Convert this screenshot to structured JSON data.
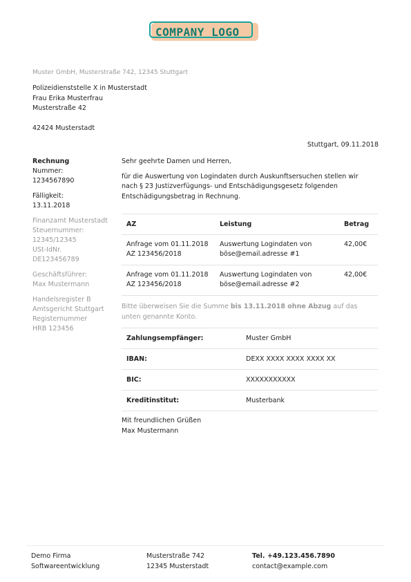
{
  "logo": {
    "text": "COMPANY LOGO"
  },
  "sender_line": "Muster GmbH, Musterstraße 742, 12345 Stuttgart",
  "recipient": {
    "lines": [
      "Polizeidienststelle X in Musterstadt",
      "Frau Erika Musterfrau",
      "Musterstraße 42"
    ],
    "city": "42424 Musterstadt"
  },
  "date": "Stuttgart, 09.11.2018",
  "sidebar": {
    "title": "Rechnung",
    "number_label": "Nummer:",
    "number": "1234567890",
    "due_label": "Fälligkeit:",
    "due": "13.11.2018",
    "tax": [
      "Finanzamt Musterstadt",
      "Steuernummer:",
      "12345/12345",
      "USt-IdNr.",
      "DE123456789"
    ],
    "ceo": [
      "Geschäftsführer:",
      "Max Mustermann"
    ],
    "register": [
      "Handelsregister B",
      "Amtsgericht Stuttgart",
      "Registernummer",
      "HRB 123456"
    ]
  },
  "body": {
    "salutation": "Sehr geehrte Damen und Herren,",
    "intro_lines": [
      "für die Auswertung von Logindaten durch Auskunftsersuchen stellen wir",
      "nach § 23 Justizverfügungs- und Entschädigungsgesetz folgenden",
      "Entschädigungsbetrag in Rechnung."
    ]
  },
  "table": {
    "headers": [
      "AZ",
      "Leistung",
      "Betrag"
    ],
    "rows": [
      {
        "az": [
          "Anfrage vom 01.11.2018",
          "AZ 123456/2018"
        ],
        "leistung": [
          "Auswertung Logindaten von",
          "böse@email.adresse #1"
        ],
        "betrag": "42,00€"
      },
      {
        "az": [
          "Anfrage vom 01.11.2018",
          "AZ 123456/2018"
        ],
        "leistung": [
          "Auswertung Logindaten von",
          "böse@email.adresse #2"
        ],
        "betrag": "42,00€"
      }
    ]
  },
  "note": {
    "pre": "Bitte überweisen Sie die Summe ",
    "bold": "bis 13.11.2018 ohne Abzug",
    "post": " auf das",
    "line2": "unten genannte Konto."
  },
  "payment": [
    {
      "key": "Zahlungsempfänger:",
      "value": "Muster GmbH"
    },
    {
      "key": "IBAN:",
      "value": "DEXX XXXX XXXX XXXX XX"
    },
    {
      "key": "BIC:",
      "value": "XXXXXXXXXXX"
    },
    {
      "key": "Kreditinstitut:",
      "value": "Musterbank"
    }
  ],
  "closing": [
    "Mit freundlichen Grüßen",
    "Max Mustermann"
  ],
  "footer": {
    "col1": [
      "Demo Firma",
      "Softwareentwicklung"
    ],
    "col2": [
      "Musterstraße 742",
      "12345 Musterstadt"
    ],
    "col3": [
      "Tel. +49.123.456.7890",
      "contact@example.com"
    ]
  }
}
